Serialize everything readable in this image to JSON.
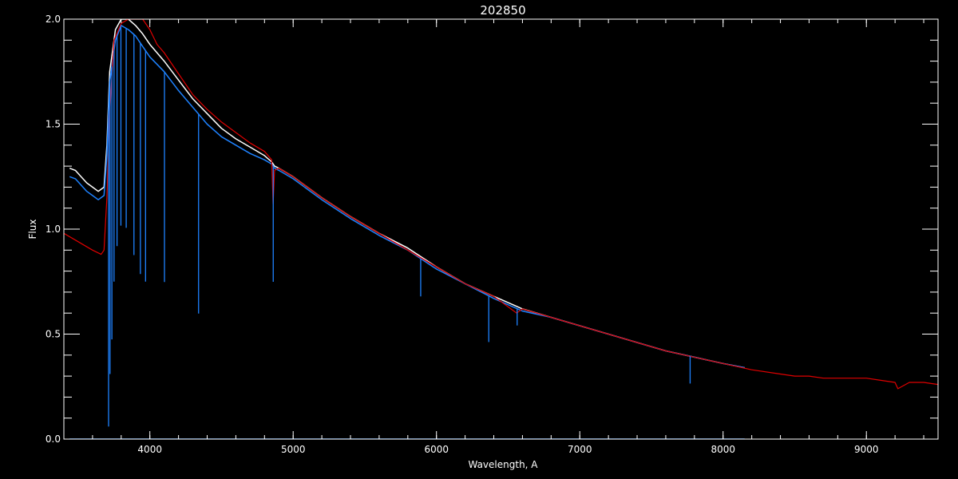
{
  "chart_data": {
    "type": "line",
    "title": "202850",
    "xlabel": "Wavelength, A",
    "ylabel": "Flux",
    "xlim": [
      3400,
      9500
    ],
    "ylim": [
      0.0,
      2.0
    ],
    "x_ticks": [
      {
        "value": 4000,
        "label": "4000"
      },
      {
        "value": 5000,
        "label": "5000"
      },
      {
        "value": 6000,
        "label": "6000"
      },
      {
        "value": 7000,
        "label": "7000"
      },
      {
        "value": 8000,
        "label": "8000"
      },
      {
        "value": 9000,
        "label": "9000"
      }
    ],
    "y_ticks": [
      {
        "value": 0.0,
        "label": "0.0"
      },
      {
        "value": 0.5,
        "label": "0.5"
      },
      {
        "value": 1.0,
        "label": "1.0"
      },
      {
        "value": 1.5,
        "label": "1.5"
      },
      {
        "value": 2.0,
        "label": "2.0"
      }
    ],
    "x_minor_step": 200,
    "y_minor_step": 0.1,
    "grid": false,
    "background": "#000000",
    "axis_color": "#ffffff",
    "series": [
      {
        "color": "#ffffff",
        "x": [
          3440,
          3480,
          3520,
          3560,
          3600,
          3640,
          3680,
          3700,
          3720,
          3760,
          3800,
          3850,
          3900,
          3950,
          4000,
          4100,
          4200,
          4300,
          4400,
          4500,
          4600,
          4700,
          4800,
          4850,
          4870,
          4900,
          5000,
          5200,
          5400,
          5600,
          5800,
          6000,
          6200,
          6400,
          6600,
          6800,
          7000,
          7200,
          7400,
          7600,
          7800,
          8000,
          8150
        ],
        "y": [
          1.29,
          1.28,
          1.25,
          1.22,
          1.2,
          1.18,
          1.2,
          1.4,
          1.75,
          1.95,
          2.0,
          2.0,
          1.97,
          1.93,
          1.88,
          1.8,
          1.71,
          1.62,
          1.55,
          1.48,
          1.43,
          1.39,
          1.35,
          1.32,
          1.3,
          1.29,
          1.25,
          1.15,
          1.06,
          0.98,
          0.91,
          0.82,
          0.74,
          0.68,
          0.62,
          0.58,
          0.54,
          0.5,
          0.46,
          0.42,
          0.39,
          0.36,
          0.34
        ]
      },
      {
        "color": "#1e82ff",
        "x": [
          3440,
          3480,
          3520,
          3560,
          3600,
          3640,
          3680,
          3700,
          3720,
          3760,
          3800,
          3850,
          3900,
          3950,
          4000,
          4100,
          4200,
          4300,
          4400,
          4500,
          4600,
          4700,
          4800,
          4850,
          4870,
          4900,
          5000,
          5200,
          5400,
          5600,
          5800,
          6000,
          6200,
          6400,
          6600,
          6800,
          7000,
          7200,
          7400,
          7600,
          7800,
          8000,
          8150
        ],
        "y": [
          1.25,
          1.24,
          1.21,
          1.18,
          1.16,
          1.14,
          1.16,
          1.35,
          1.7,
          1.9,
          1.97,
          1.95,
          1.92,
          1.87,
          1.82,
          1.75,
          1.66,
          1.58,
          1.5,
          1.44,
          1.4,
          1.36,
          1.33,
          1.31,
          1.29,
          1.28,
          1.24,
          1.14,
          1.05,
          0.97,
          0.9,
          0.81,
          0.74,
          0.67,
          0.61,
          0.58,
          0.54,
          0.5,
          0.46,
          0.42,
          0.39,
          0.36,
          0.34
        ]
      },
      {
        "color": "#e00000",
        "x": [
          3400,
          3500,
          3600,
          3660,
          3680,
          3700,
          3720,
          3750,
          3800,
          3850,
          3900,
          3950,
          4000,
          4050,
          4100,
          4200,
          4300,
          4400,
          4500,
          4600,
          4700,
          4800,
          4850,
          4860,
          4870,
          4900,
          5000,
          5200,
          5400,
          5600,
          5800,
          6000,
          6200,
          6400,
          6560,
          6600,
          6800,
          7000,
          7200,
          7400,
          7600,
          7800,
          8000,
          8200,
          8400,
          8500,
          8600,
          8700,
          8800,
          8900,
          9000,
          9100,
          9200,
          9220,
          9300,
          9400,
          9500
        ],
        "y": [
          0.98,
          0.94,
          0.9,
          0.88,
          0.9,
          1.15,
          1.55,
          1.9,
          1.98,
          2.0,
          2.0,
          2.0,
          1.95,
          1.88,
          1.84,
          1.74,
          1.64,
          1.57,
          1.51,
          1.46,
          1.41,
          1.37,
          1.33,
          1.12,
          1.28,
          1.29,
          1.25,
          1.15,
          1.06,
          0.98,
          0.9,
          0.82,
          0.74,
          0.68,
          0.6,
          0.62,
          0.58,
          0.54,
          0.5,
          0.46,
          0.42,
          0.39,
          0.36,
          0.33,
          0.31,
          0.3,
          0.3,
          0.29,
          0.29,
          0.29,
          0.29,
          0.28,
          0.27,
          0.24,
          0.27,
          0.27,
          0.26
        ]
      },
      {
        "color": "#1e82ff",
        "x": [
          3440,
          4000,
          5000,
          6000,
          7000,
          8000,
          8150
        ],
        "y": [
          0.0,
          0.0,
          0.0,
          0.0,
          0.0,
          0.0,
          0.0
        ]
      }
    ],
    "absorption_lines": [
      {
        "x": 3712,
        "depth": 1.5
      },
      {
        "x": 3722,
        "depth": 1.4
      },
      {
        "x": 3735,
        "depth": 1.3
      },
      {
        "x": 3750,
        "depth": 1.1
      },
      {
        "x": 3771,
        "depth": 1.0
      },
      {
        "x": 3798,
        "depth": 0.95
      },
      {
        "x": 3835,
        "depth": 0.95
      },
      {
        "x": 3889,
        "depth": 1.05
      },
      {
        "x": 3934,
        "depth": 1.1
      },
      {
        "x": 3970,
        "depth": 1.1
      },
      {
        "x": 4102,
        "depth": 1.0
      },
      {
        "x": 4340,
        "depth": 0.95
      },
      {
        "x": 4861,
        "depth": 0.55
      },
      {
        "x": 5890,
        "depth": 0.18
      },
      {
        "x": 6365,
        "depth": 0.22
      },
      {
        "x": 6563,
        "depth": 0.08
      },
      {
        "x": 7770,
        "depth": 0.13
      }
    ]
  }
}
